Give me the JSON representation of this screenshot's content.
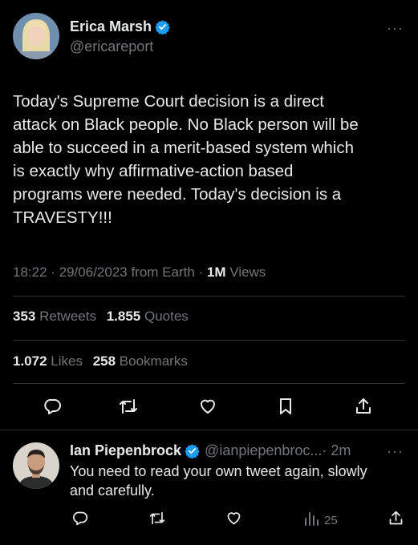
{
  "tweet": {
    "author_name": "Erica Marsh",
    "author_handle": "@ericareport",
    "text_lines": [
      "Today's Supreme Court decision is a direct",
      "attack on Black people. No Black person will be",
      "able to succeed in a merit-based system which",
      "is exactly why affirmative-action based",
      "programs were needed. Today's decision is a",
      "TRAVESTY!!!"
    ],
    "timestamp": "18:22 · 29/06/2023 from Earth · ",
    "views_count": "1M",
    "views_label": " Views",
    "retweets_count": "353",
    "retweets_label": " Retweets",
    "quotes_count": "1.855",
    "quotes_label": " Quotes",
    "likes_count": "1.072",
    "likes_label": " Likes",
    "bookmarks_count": "258",
    "bookmarks_label": " Bookmarks",
    "more_glyph": "···"
  },
  "reply": {
    "author_name": "Ian Piepenbrock",
    "author_handle": "@ianpiepenbroc...",
    "time": " · 2m",
    "text_lines": [
      "You need to read your own tweet again, slowly",
      "and carefully."
    ],
    "views": "25",
    "more_glyph": "···"
  },
  "colors": {
    "background": "#000000",
    "text": "#e7e9ea",
    "muted": "#71767b",
    "verified": "#1d9bf0",
    "divider": "#2f3336"
  },
  "icons": [
    "reply-icon",
    "retweet-icon",
    "like-icon",
    "bookmark-icon",
    "share-icon",
    "views-icon",
    "verified-icon",
    "more-icon"
  ]
}
